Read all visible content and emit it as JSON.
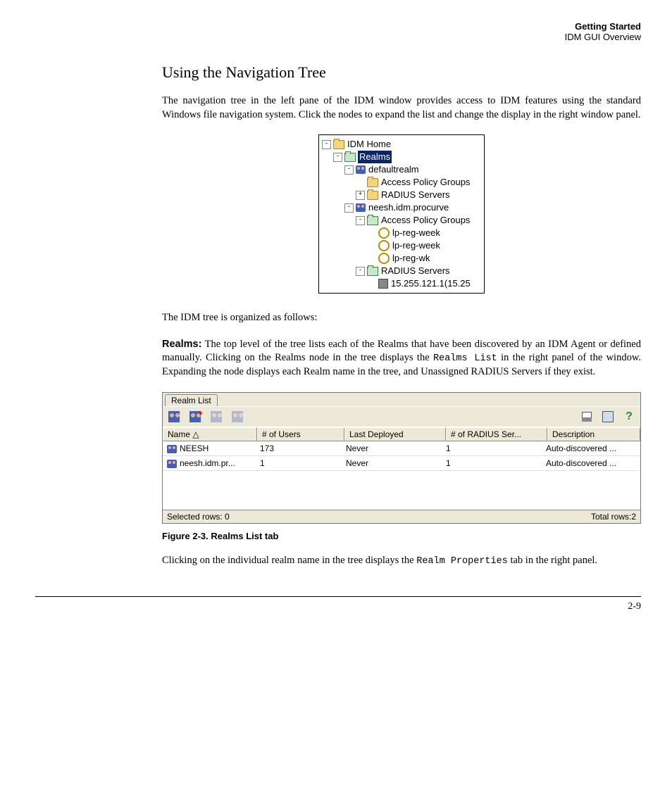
{
  "header": {
    "section": "Getting Started",
    "subsection": "IDM GUI Overview"
  },
  "title": "Using the Navigation Tree",
  "intro_para": "The navigation tree in the left pane of the IDM window provides access to IDM features using the standard Windows file navigation system. Click the nodes to expand the list and change the display in the right window panel.",
  "tree": {
    "items": [
      {
        "indent": 0,
        "exp": "-",
        "icon": "folder",
        "label": "IDM Home",
        "selected": false
      },
      {
        "indent": 1,
        "exp": "-",
        "icon": "folder-open",
        "label": "Realms",
        "selected": true
      },
      {
        "indent": 2,
        "exp": "-",
        "icon": "people",
        "label": "defaultrealm",
        "selected": false
      },
      {
        "indent": 3,
        "exp": "",
        "icon": "folder",
        "label": "Access Policy Groups",
        "selected": false
      },
      {
        "indent": 3,
        "exp": "+",
        "icon": "folder",
        "label": "RADIUS Servers",
        "selected": false
      },
      {
        "indent": 2,
        "exp": "-",
        "icon": "people",
        "label": "neesh.idm.procurve",
        "selected": false
      },
      {
        "indent": 3,
        "exp": "-",
        "icon": "folder-open",
        "label": "Access Policy Groups",
        "selected": false
      },
      {
        "indent": 4,
        "exp": "",
        "icon": "gear",
        "label": "lp-reg-week",
        "selected": false
      },
      {
        "indent": 4,
        "exp": "",
        "icon": "gear",
        "label": "lp-reg-week",
        "selected": false
      },
      {
        "indent": 4,
        "exp": "",
        "icon": "gear",
        "label": "lp-reg-wk",
        "selected": false
      },
      {
        "indent": 3,
        "exp": "-",
        "icon": "folder-open",
        "label": "RADIUS Servers",
        "selected": false
      },
      {
        "indent": 4,
        "exp": "",
        "icon": "server",
        "label": "15.255.121.1(15.25",
        "selected": false
      }
    ]
  },
  "organized_para": "The IDM tree is organized as follows:",
  "realms_label": "Realms:",
  "realms_para_before": " The top level of the tree lists each of the Realms that have been discovered by an IDM Agent or defined manually. Clicking on the Realms node in the tree displays the ",
  "realms_mono": "Realms List",
  "realms_para_after": " in the right panel of the window. Expanding the node displays each Realm name in the tree, and Unassigned RADIUS Servers if they exist.",
  "realmlist": {
    "tab": "Realm List",
    "columns": [
      "Name  △",
      "# of Users",
      "Last Deployed",
      "# of RADIUS Ser...",
      "Description"
    ],
    "rows": [
      {
        "name": "NEESH",
        "users": "173",
        "deployed": "Never",
        "radius": "1",
        "desc": "Auto-discovered ..."
      },
      {
        "name": "neesh.idm.pr...",
        "users": "1",
        "deployed": "Never",
        "radius": "1",
        "desc": "Auto-discovered ..."
      }
    ],
    "selected": "Selected rows: 0",
    "total": "Total rows:2"
  },
  "fig_caption": "Figure 2-3. Realms List tab",
  "closing_before": "Clicking on the individual realm name in the tree displays the ",
  "closing_mono": "Realm Properties",
  "closing_after": " tab in the right panel.",
  "page_num": "2-9"
}
